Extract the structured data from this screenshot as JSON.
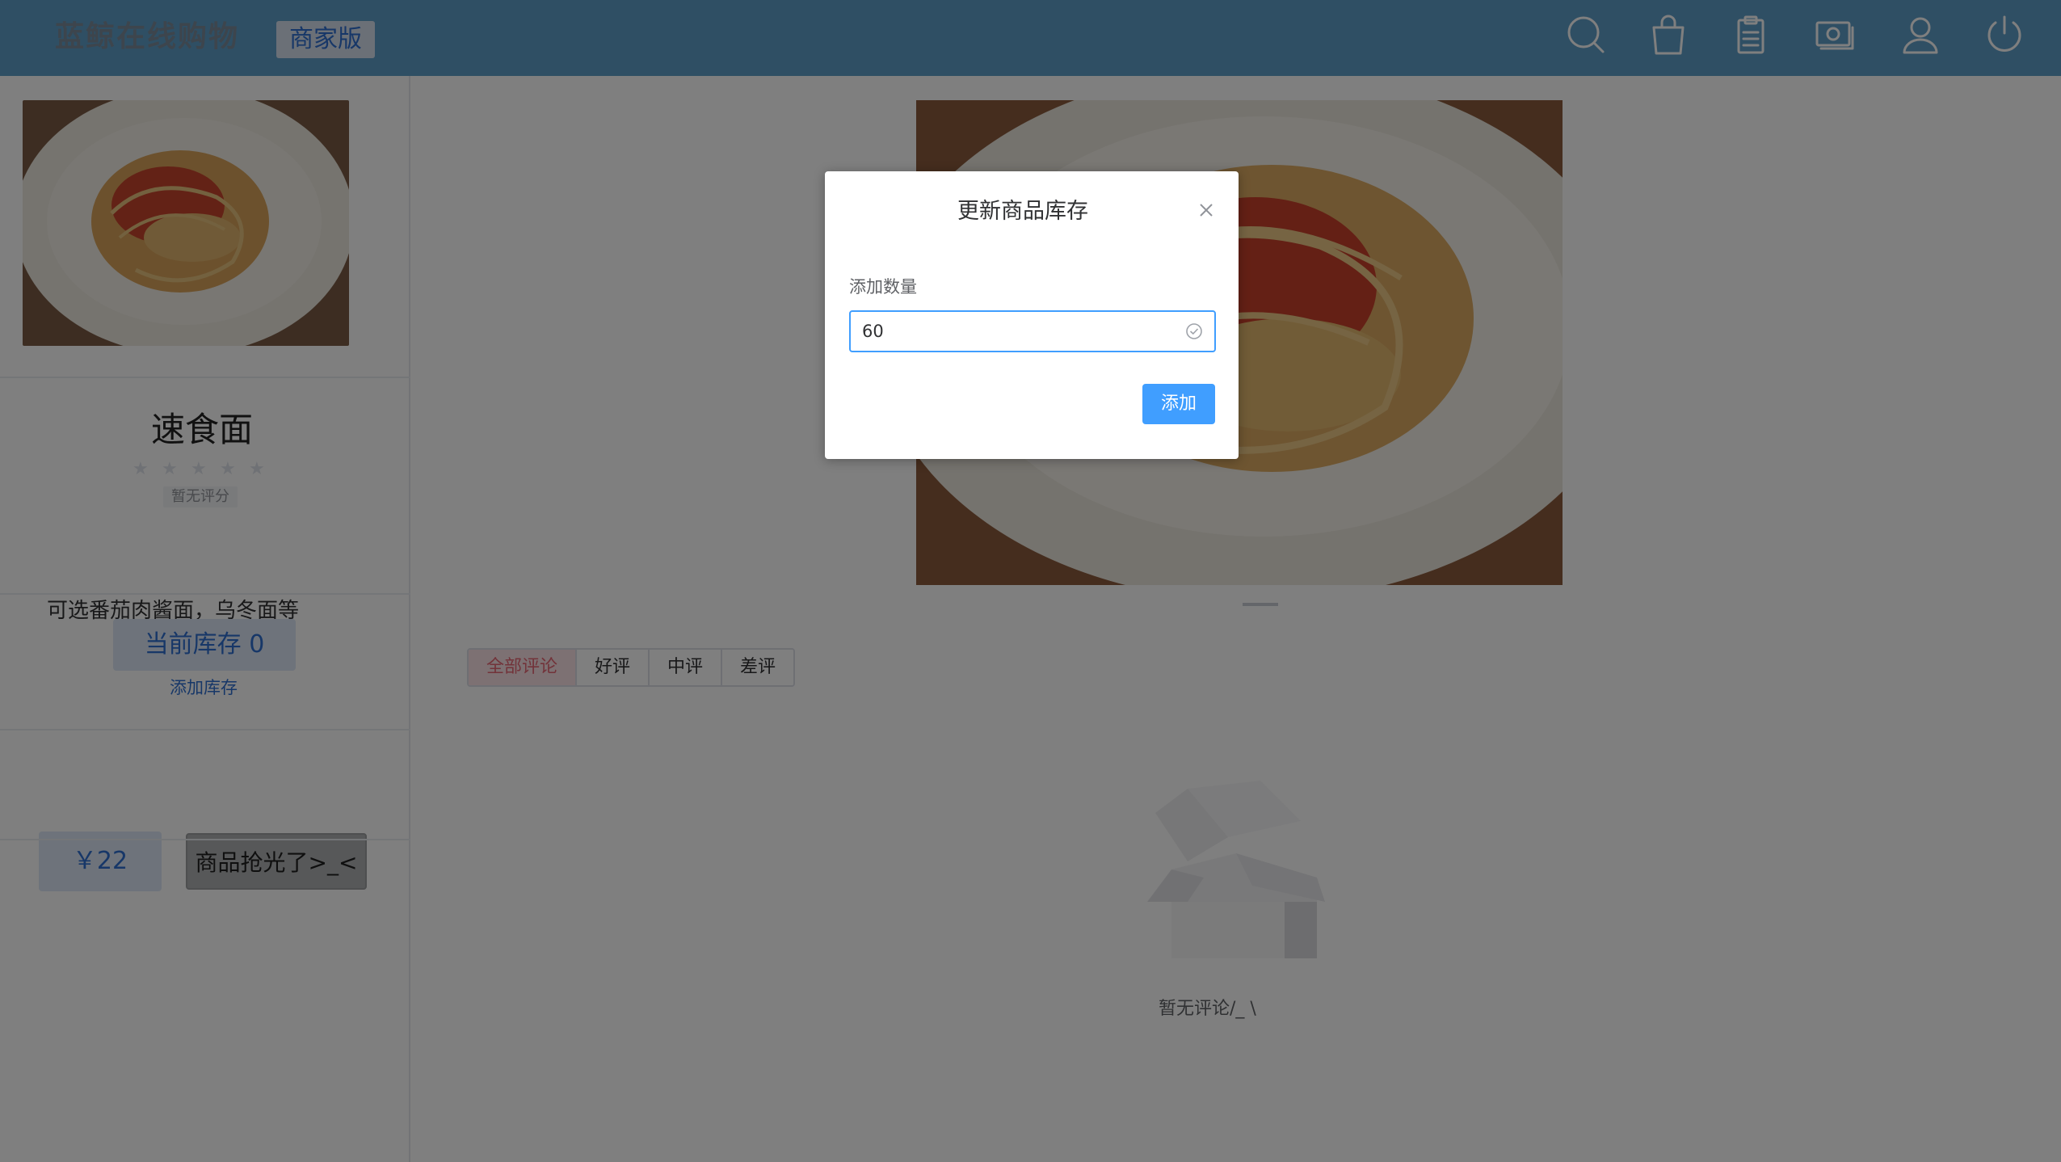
{
  "header": {
    "brand": "蓝鲸在线购物",
    "edition": "商家版",
    "icons": [
      "search-icon",
      "shopping-bag-icon",
      "clipboard-icon",
      "money-icon",
      "user-icon",
      "power-icon"
    ]
  },
  "product": {
    "name": "速食面",
    "rating_text": "暂无评分",
    "rating_stars": 0,
    "description": "可选番茄肉酱面，乌冬面等",
    "stock_label": "当前库存 0",
    "add_stock_link": "添加库存",
    "price": "￥22",
    "sold_out_label": "商品抢光了>_<"
  },
  "carousel": {
    "slide_count": 2,
    "active_index": 0
  },
  "reviews": {
    "tabs": [
      "全部评论",
      "好评",
      "中评",
      "差评"
    ],
    "active_tab": 0,
    "empty_text": "暂无评论/_ \\"
  },
  "dialog": {
    "title": "更新商品库存",
    "field_label": "添加数量",
    "field_value": "60",
    "submit_label": "添加"
  },
  "colors": {
    "header": "#5f9fc8",
    "primary": "#409eff",
    "overlay": "rgba(0,0,0,0.5)"
  }
}
